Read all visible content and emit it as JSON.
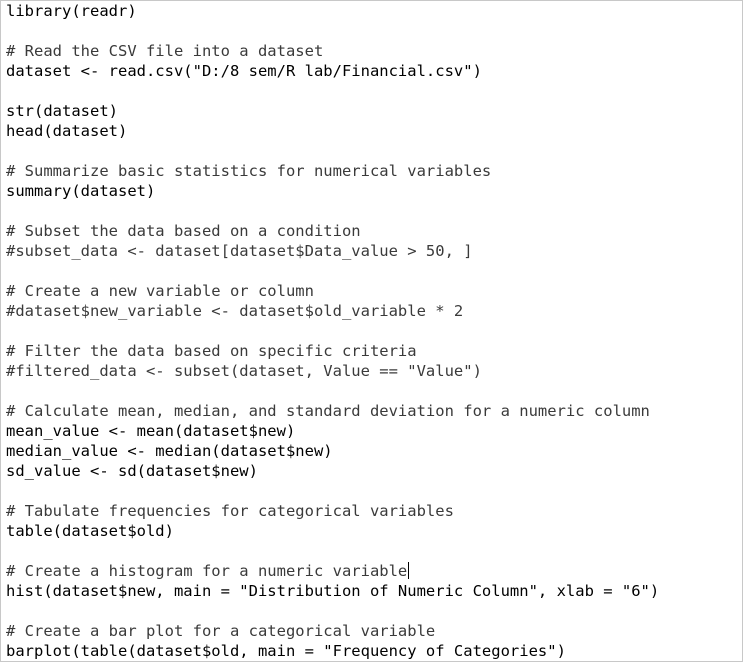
{
  "editor": {
    "lines": [
      {
        "text": "library(readr)",
        "kind": "code"
      },
      {
        "text": "",
        "kind": "blank"
      },
      {
        "text": "# Read the CSV file into a dataset",
        "kind": "comment"
      },
      {
        "text": "dataset <- read.csv(\"D:/8 sem/R lab/Financial.csv\")",
        "kind": "code"
      },
      {
        "text": "",
        "kind": "blank"
      },
      {
        "text": "str(dataset)",
        "kind": "code"
      },
      {
        "text": "head(dataset)",
        "kind": "code"
      },
      {
        "text": "",
        "kind": "blank"
      },
      {
        "text": "# Summarize basic statistics for numerical variables",
        "kind": "comment"
      },
      {
        "text": "summary(dataset)",
        "kind": "code"
      },
      {
        "text": "",
        "kind": "blank"
      },
      {
        "text": "# Subset the data based on a condition",
        "kind": "comment"
      },
      {
        "text": "#subset_data <- dataset[dataset$Data_value > 50, ]",
        "kind": "comment"
      },
      {
        "text": "",
        "kind": "blank"
      },
      {
        "text": "# Create a new variable or column",
        "kind": "comment"
      },
      {
        "text": "#dataset$new_variable <- dataset$old_variable * 2",
        "kind": "comment"
      },
      {
        "text": "",
        "kind": "blank"
      },
      {
        "text": "# Filter the data based on specific criteria",
        "kind": "comment"
      },
      {
        "text": "#filtered_data <- subset(dataset, Value == \"Value\")",
        "kind": "comment"
      },
      {
        "text": "",
        "kind": "blank"
      },
      {
        "text": "# Calculate mean, median, and standard deviation for a numeric column",
        "kind": "comment"
      },
      {
        "text": "mean_value <- mean(dataset$new)",
        "kind": "code"
      },
      {
        "text": "median_value <- median(dataset$new)",
        "kind": "code"
      },
      {
        "text": "sd_value <- sd(dataset$new)",
        "kind": "code"
      },
      {
        "text": "",
        "kind": "blank"
      },
      {
        "text": "# Tabulate frequencies for categorical variables",
        "kind": "comment"
      },
      {
        "text": "table(dataset$old)",
        "kind": "code"
      },
      {
        "text": "",
        "kind": "blank"
      },
      {
        "text": "# Create a histogram for a numeric variable",
        "kind": "comment",
        "caret": true
      },
      {
        "text": "hist(dataset$new, main = \"Distribution of Numeric Column\", xlab = \"6\")",
        "kind": "code"
      },
      {
        "text": "",
        "kind": "blank"
      },
      {
        "text": "# Create a bar plot for a categorical variable",
        "kind": "comment"
      },
      {
        "text": "barplot(table(dataset$old, main = \"Frequency of Categories\")",
        "kind": "code"
      }
    ]
  }
}
